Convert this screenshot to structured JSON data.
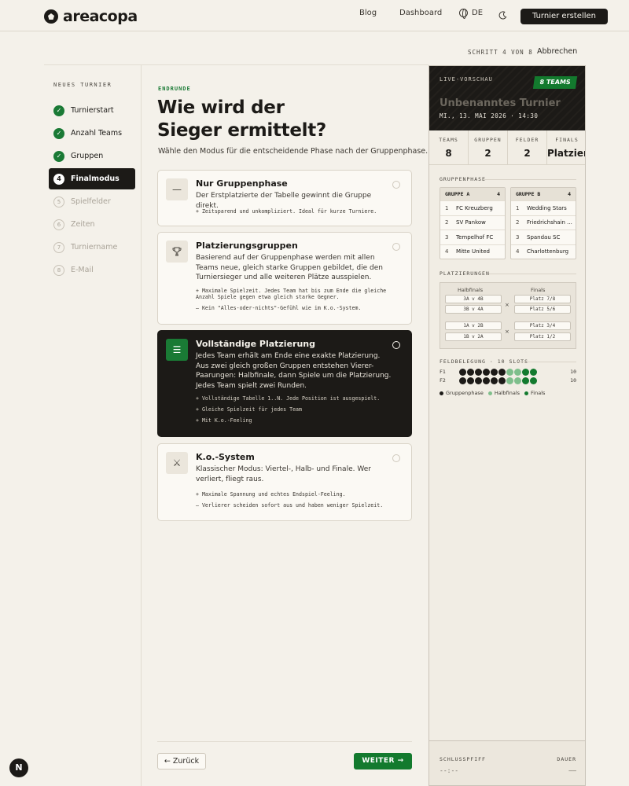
{
  "header": {
    "logo": "areacopa",
    "nav_blog": "Blog",
    "nav_dashboard": "Dashboard",
    "lang": "DE",
    "create_button": "Turnier erstellen"
  },
  "wizard": {
    "step_info": "SCHRITT 4 VON 8",
    "cancel": "Abbrechen",
    "sidebar_title": "NEUES TURNIER",
    "steps": [
      {
        "label": "Turnierstart",
        "status": "done",
        "num": "1"
      },
      {
        "label": "Anzahl Teams",
        "status": "done",
        "num": "2"
      },
      {
        "label": "Gruppen",
        "status": "done",
        "num": "3"
      },
      {
        "label": "Finalmodus",
        "status": "active",
        "num": "4"
      },
      {
        "label": "Spielfelder",
        "status": "todo",
        "num": "5"
      },
      {
        "label": "Zeiten",
        "status": "todo",
        "num": "6"
      },
      {
        "label": "Turniername",
        "status": "todo",
        "num": "7"
      },
      {
        "label": "E-Mail",
        "status": "todo",
        "num": "8"
      }
    ]
  },
  "main": {
    "eyebrow": "ENDRUNDE",
    "title_line1": "Wie wird der",
    "title_line2": "Sieger ermittelt?",
    "subtitle": "Wähle den Modus für die entscheidende Phase nach der Gruppenphase.",
    "options": [
      {
        "title": "Nur Gruppenphase",
        "desc": "Der Erstplatzierte der Tabelle gewinnt die Gruppe direkt.",
        "bullets": [
          "+ Zeitsparend und unkompliziert. Ideal für kurze Turniere."
        ],
        "icon": "dash-icon",
        "selected": false
      },
      {
        "title": "Platzierungsgruppen",
        "desc": "Basierend auf der Gruppenphase werden mit allen Teams neue, gleich starke Gruppen gebildet, die den Turniersieger und alle weiteren Plätze ausspielen.",
        "bullets": [
          "+ Maximale Spielzeit. Jedes Team hat bis zum Ende die gleiche Anzahl Spiele gegen etwa gleich starke Gegner.",
          "– Kein \"Alles-oder-nichts\"-Gefühl wie im K.o.-System."
        ],
        "icon": "trophy-icon",
        "selected": false
      },
      {
        "title": "Vollständige Platzierung",
        "desc": "Jedes Team erhält am Ende eine exakte Platzierung. Aus zwei gleich großen Gruppen entstehen Vierer-Paarungen: Halbfinale, dann Spiele um die Platzierung. Jedes Team spielt zwei Runden.",
        "bullets": [
          "+ Vollständige Tabelle 1..N. Jede Position ist ausgespielt.",
          "+ Gleiche Spielzeit für jedes Team",
          "+ Mit K.o.-Feeling"
        ],
        "icon": "ordered-list-icon",
        "selected": true
      },
      {
        "title": "K.o.-System",
        "desc": "Klassischer Modus: Viertel-, Halb- und Finale. Wer verliert, fliegt raus.",
        "bullets": [
          "+ Maximale Spannung und echtes Endspiel-Feeling.",
          "– Verlierer scheiden sofort aus und haben weniger Spielzeit."
        ],
        "icon": "crossed-swords-icon",
        "selected": false
      }
    ],
    "back_button": "← Zurück",
    "next_button": "WEITER →"
  },
  "preview": {
    "live_label": "LIVE-VORSCHAU",
    "badge": "8 TEAMS",
    "name": "Unbenanntes Turnier",
    "date": "MI., 13. MAI 2026 · 14:30",
    "stats": [
      {
        "label": "TEAMS",
        "value": "8"
      },
      {
        "label": "GRUPPEN",
        "value": "2"
      },
      {
        "label": "FELDER",
        "value": "2"
      },
      {
        "label": "FINALS",
        "value": "Platzier"
      }
    ],
    "groups_label": "GRUPPENPHASE",
    "groups": [
      {
        "name": "GRUPPE A",
        "count": "4",
        "teams": [
          {
            "n": "1",
            "name": "FC Kreuzberg"
          },
          {
            "n": "2",
            "name": "SV Pankow"
          },
          {
            "n": "3",
            "name": "Tempelhof FC"
          },
          {
            "n": "4",
            "name": "Mitte United"
          }
        ]
      },
      {
        "name": "GRUPPE B",
        "count": "4",
        "teams": [
          {
            "n": "1",
            "name": "Wedding Stars"
          },
          {
            "n": "2",
            "name": "Friedrichshain ..."
          },
          {
            "n": "3",
            "name": "Spandau SC"
          },
          {
            "n": "4",
            "name": "Charlottenburg"
          }
        ]
      }
    ],
    "placements_label": "PLATZIERUNGEN",
    "bracket": {
      "semis_label": "Halbfinals",
      "finals_label": "Finals",
      "semis": [
        "3A v 4B",
        "3B v 4A",
        "1A v 2B",
        "1B v 2A"
      ],
      "finals": [
        "Platz 7/8",
        "Platz 5/6",
        "Platz 3/4",
        "Platz 1/2"
      ],
      "vs": "×"
    },
    "fields_label": "FELDBELEGUNG · 10 SLOTS",
    "fields": [
      {
        "name": "F1",
        "count": "10",
        "slots": [
          "g",
          "g",
          "g",
          "g",
          "g",
          "g",
          "h",
          "h",
          "f",
          "f"
        ]
      },
      {
        "name": "F2",
        "count": "10",
        "slots": [
          "g",
          "g",
          "g",
          "g",
          "g",
          "g",
          "h",
          "h",
          "f",
          "f"
        ]
      }
    ],
    "legend": [
      {
        "key": "g",
        "label": "Gruppenphase",
        "color": "#1c1a17"
      },
      {
        "key": "h",
        "label": "Halbfinals",
        "color": "#7fbf8c"
      },
      {
        "key": "f",
        "label": "Finals",
        "color": "#137a2e"
      }
    ],
    "footer_left_label": "SCHLUSSPFIFF",
    "footer_right_label": "DAUER",
    "footer_left_value": "--:--",
    "footer_right_value": "——"
  },
  "fab": "N"
}
